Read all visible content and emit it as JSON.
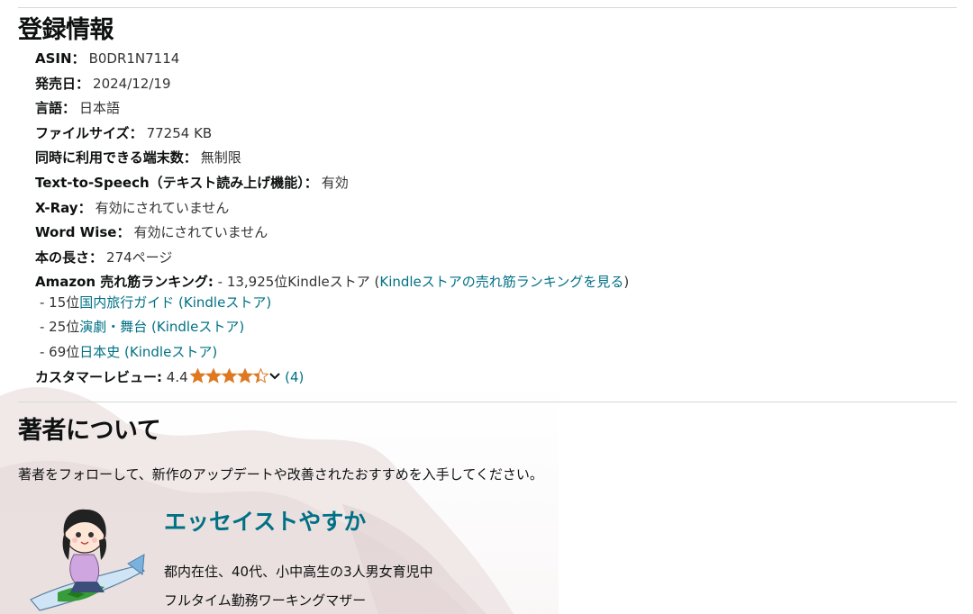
{
  "product_details": {
    "heading": "登録情報",
    "rows": [
      {
        "label": "ASIN",
        "value": "B0DR1N7114"
      },
      {
        "label": "発売日",
        "value": "2024/12/19"
      },
      {
        "label": "言語",
        "value": "日本語"
      },
      {
        "label": "ファイルサイズ",
        "value": "77254 KB"
      },
      {
        "label": "同時に利用できる端末数",
        "value": "無制限"
      },
      {
        "label": "Text-to-Speech（テキスト読み上げ機能）",
        "value": "有効"
      },
      {
        "label": "X-Ray",
        "value": "有効にされていません"
      },
      {
        "label": "Word Wise",
        "value": "有効にされていません"
      },
      {
        "label": "本の長さ",
        "value": "274ページ"
      }
    ],
    "separator": "：",
    "ranking": {
      "label": "Amazon 売れ筋ランキング:",
      "main_rank": "- 13,925位Kindleストア (",
      "main_link": "Kindleストアの売れ筋ランキングを見る",
      "main_close": ")",
      "sub_ranks": [
        {
          "rank": "- 15位",
          "category": "国内旅行ガイド (Kindleストア)"
        },
        {
          "rank": "- 25位",
          "category": "演劇・舞台 (Kindleストア)"
        },
        {
          "rank": "- 69位",
          "category": "日本史 (Kindleストア)"
        }
      ]
    },
    "reviews": {
      "label": "カスタマーレビュー:",
      "rating": "4.4",
      "stars_value": 4.4,
      "stars_max": 5,
      "count": "(4)"
    }
  },
  "author_section": {
    "heading": "著者について",
    "follow_text": "著者をフォローして、新作のアップデートや改善されたおすすめを入手してください。",
    "author_name": "エッセイストやすか",
    "bio_lines": [
      "都内在住、40代、小中高生の3人男女育児中",
      "フルタイム勤務ワーキングマザー"
    ]
  },
  "colors": {
    "link": "#007185",
    "star": "#de7921",
    "divider": "#d5d9d9"
  }
}
